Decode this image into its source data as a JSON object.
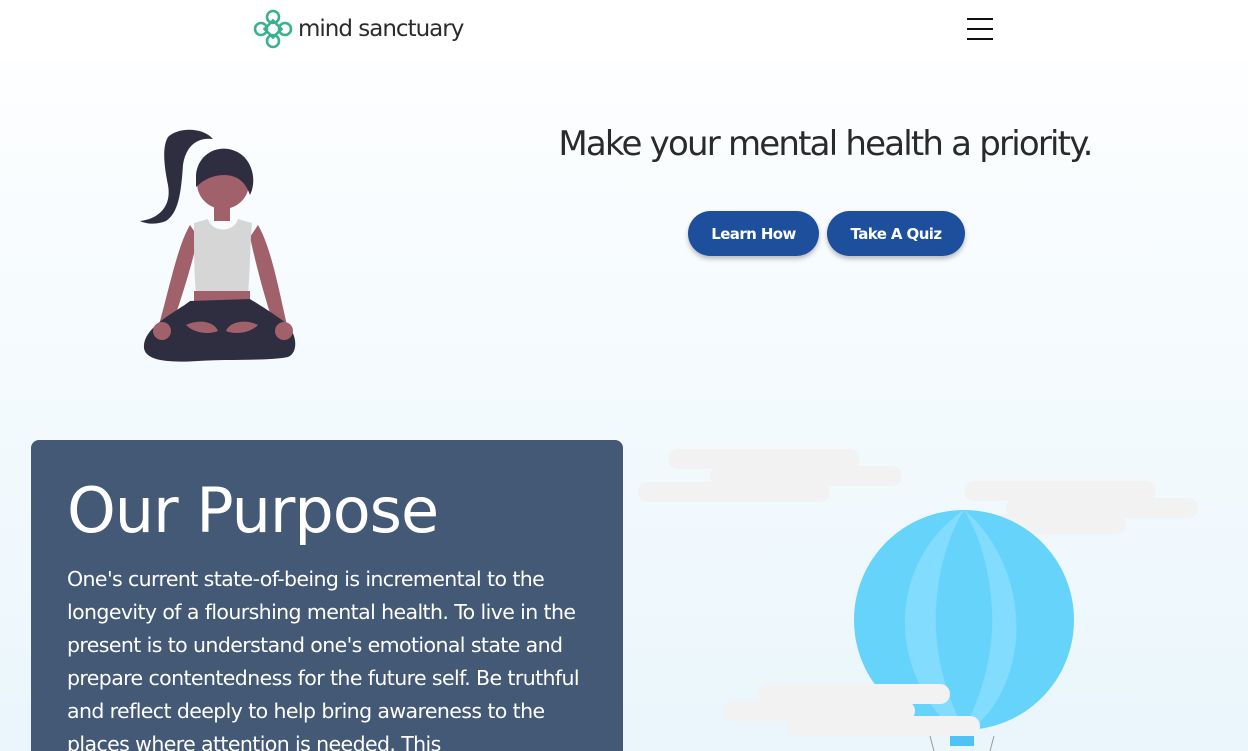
{
  "header": {
    "brand": "mind sanctuary",
    "logo_icon": "celtic-knot-logo",
    "menu_icon": "hamburger-menu-icon"
  },
  "hero": {
    "headline": "Make your mental health a priority.",
    "illustration": "meditating-woman",
    "buttons": [
      {
        "label": "Learn How"
      },
      {
        "label": "Take A Quiz"
      }
    ]
  },
  "purpose": {
    "title": "Our Purpose",
    "body": "One's current state-of-being is incremental to the longevity of a flourshing mental health. To live in the present is to understand one's emotional state and prepare contentedness for the future self. Be truthful and reflect deeply to help bring awareness to the places where attention is needed. This"
  },
  "scene": {
    "illustration": "hot-air-balloon-with-clouds"
  },
  "colors": {
    "button": "#1e4f9c",
    "purpose_card": "#445976",
    "logo_green": "#3bb08f",
    "balloon": "#66d3fb",
    "cloud": "#f2f2f2"
  }
}
